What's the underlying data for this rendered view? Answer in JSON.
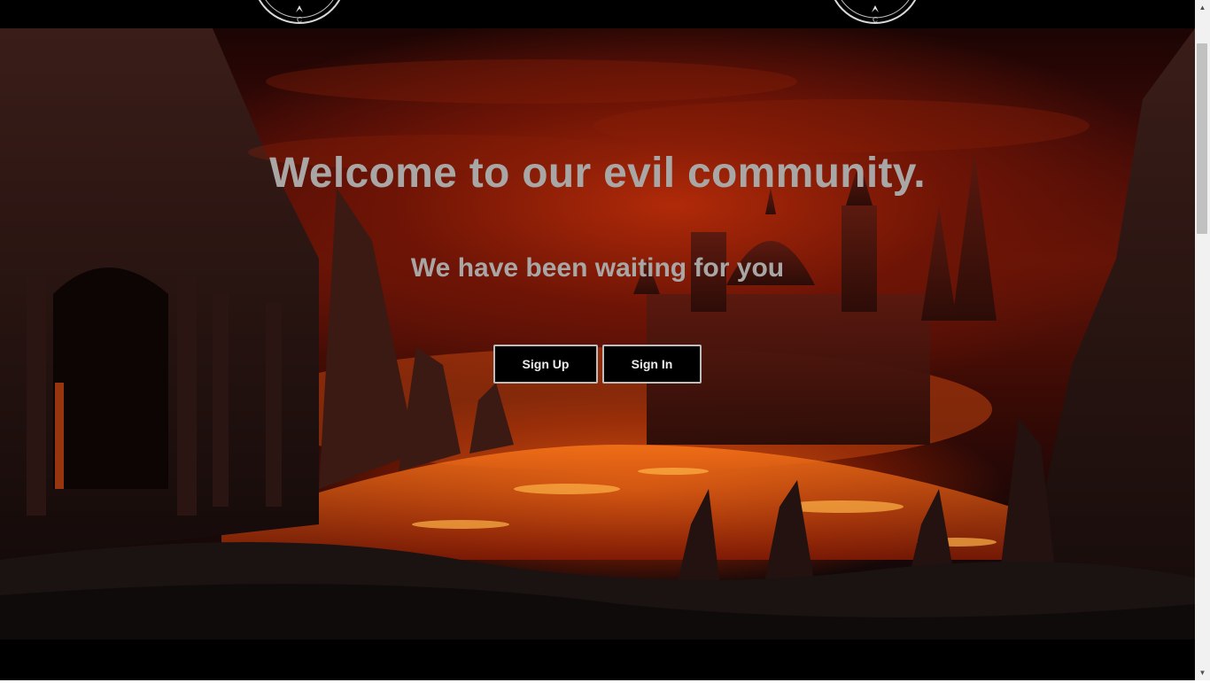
{
  "hero": {
    "title": "Welcome to our evil community.",
    "subtitle": "We have been waiting for you"
  },
  "buttons": {
    "signup_label": "Sign Up",
    "signin_label": "Sign In"
  },
  "scrollbar": {
    "up_glyph": "▲",
    "down_glyph": "▼"
  },
  "colors": {
    "text": "#a9a7a6",
    "button_bg": "#000000",
    "button_border": "#bdbdbd",
    "bar_bg": "#000000"
  },
  "icons": {
    "emblem_left": "pentagram-seal-icon",
    "emblem_right": "pentagram-seal-icon"
  }
}
